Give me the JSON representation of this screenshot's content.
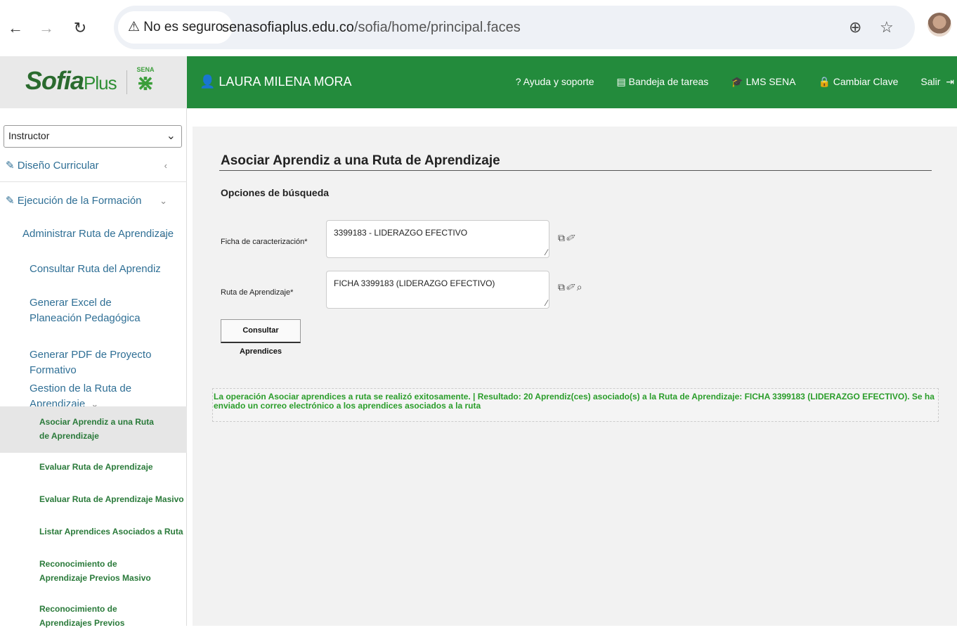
{
  "browser": {
    "back_icon": "arrow-left-icon",
    "forward_icon": "arrow-right-icon",
    "reload_icon": "reload-icon",
    "security_chip": "⚠ No es seguro",
    "url_host": "senasofiaplus.edu.co",
    "url_path": "/sofia/home/principal.faces",
    "zoom_icon": "zoom-icon",
    "bookmark_icon": "star-icon"
  },
  "logo": {
    "brand": "Sofia",
    "brand_plus": "Plus",
    "sena": "SENA"
  },
  "topbar": {
    "user": "LAURA MILENA MORA",
    "links": [
      "Ayuda y soporte",
      "Bandeja de tareas",
      "LMS SENA",
      "Cambiar Clave",
      "Salir"
    ]
  },
  "sidebar": {
    "role": "Instructor",
    "sections": [
      {
        "label": "Diseño Curricular",
        "chevron": "‹"
      },
      {
        "label": "Ejecución de la Formación",
        "chevron": "⌄"
      }
    ],
    "group": {
      "label": "Administrar Ruta de Aprendizaje",
      "chevron": "⌄"
    },
    "sub_items": [
      "Consultar Ruta del Aprendiz",
      "Generar Excel de Planeación Pedagógica",
      "Generar PDF de Proyecto Formativo"
    ],
    "sub_group": {
      "label": "Gestion de la Ruta de Aprendizaje",
      "chevron": "⌄"
    },
    "leaves": [
      "Asociar Aprendiz a una Ruta de Aprendizaje",
      "Evaluar Ruta de Aprendizaje",
      "Evaluar Ruta de Aprendizaje Masivo",
      "Listar Aprendices Asociados a Ruta",
      "Reconocimiento de Aprendizaje Previos Masivo",
      "Reconocimiento de Aprendizajes Previos"
    ]
  },
  "main": {
    "title": "Asociar Aprendiz a una Ruta de Aprendizaje",
    "subtitle": "Opciones de búsqueda",
    "ficha_label": "Ficha de caracterización*",
    "ficha_value": "3399183 - LIDERAZGO EFECTIVO",
    "ruta_label": "Ruta de Aprendizaje*",
    "ruta_value": "FICHA 3399183 (LIDERAZGO EFECTIVO)",
    "button": "Consultar Aprendices",
    "message": "La operación Asociar aprendices a ruta se realizó exitosamente. | Resultado: 20 Aprendiz(ces) asociado(s) a la Ruta de Aprendizaje: FICHA 3399183 (LIDERAZGO EFECTIVO). Se ha enviado un correo electrónico a los aprendices asociados a la ruta"
  }
}
